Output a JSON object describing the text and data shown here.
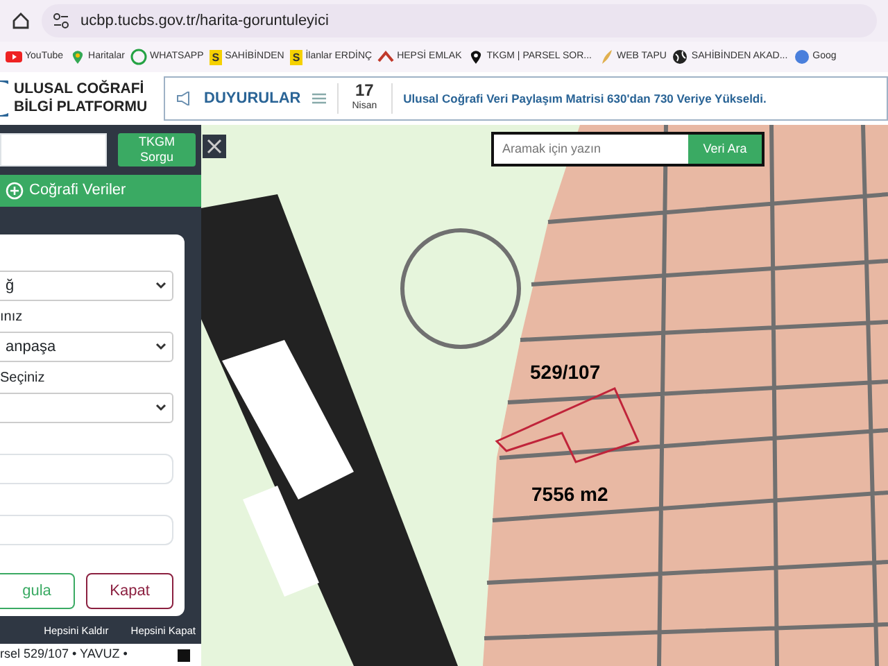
{
  "browser": {
    "url": "ucbp.tucbs.gov.tr/harita-goruntuleyici",
    "bookmarks": [
      {
        "label": "YouTube",
        "kind": "youtube"
      },
      {
        "label": "Haritalar",
        "kind": "maps"
      },
      {
        "label": "WHATSAPP",
        "kind": "whatsapp"
      },
      {
        "label": "SAHİBİNDEN",
        "kind": "letter",
        "badge": "S"
      },
      {
        "label": "İlanlar ERDİNÇ",
        "kind": "letter",
        "badge": "S"
      },
      {
        "label": "HEPSİ EMLAK",
        "kind": "roof"
      },
      {
        "label": "TKGM | PARSEL SOR...",
        "kind": "pin"
      },
      {
        "label": "WEB TAPU",
        "kind": "feather"
      },
      {
        "label": "SAHİBİNDEN AKAD...",
        "kind": "globe"
      },
      {
        "label": "Goog",
        "kind": "ball"
      }
    ]
  },
  "header": {
    "logo_lines": [
      "ULUSAL COĞRAFİ",
      "BİLGİ PLATFORMU"
    ],
    "announcements": {
      "title": "DUYURULAR",
      "day": "17",
      "month": "Nisan",
      "message": "Ulusal Coğrafi Veri Paylaşım Matrisi 630'dan 730 Veriye Yükseldi."
    }
  },
  "panel": {
    "query_button": "TKGM Sorgu",
    "section": "Coğrafi Veriler",
    "fields": [
      {
        "kind": "select",
        "value": "ğ"
      },
      {
        "kind": "select",
        "label": "ınız",
        "value": "anpaşa"
      },
      {
        "kind": "select",
        "label": "Seçiniz"
      },
      {
        "kind": "input"
      },
      {
        "kind": "input"
      }
    ],
    "buttons": [
      {
        "label": "gula",
        "kind": "success"
      },
      {
        "label": "Kapat",
        "kind": "danger"
      }
    ],
    "toolbar": [
      "Hepsini Kaldır",
      "Hepsini Kapat"
    ],
    "result": "rsel 529/107 • YAVUZ •"
  },
  "map": {
    "search_placeholder": "Aramak için yazın",
    "search_button": "Veri Ara",
    "parcel_number": "529/107",
    "parcel_area": "7556 m2"
  }
}
